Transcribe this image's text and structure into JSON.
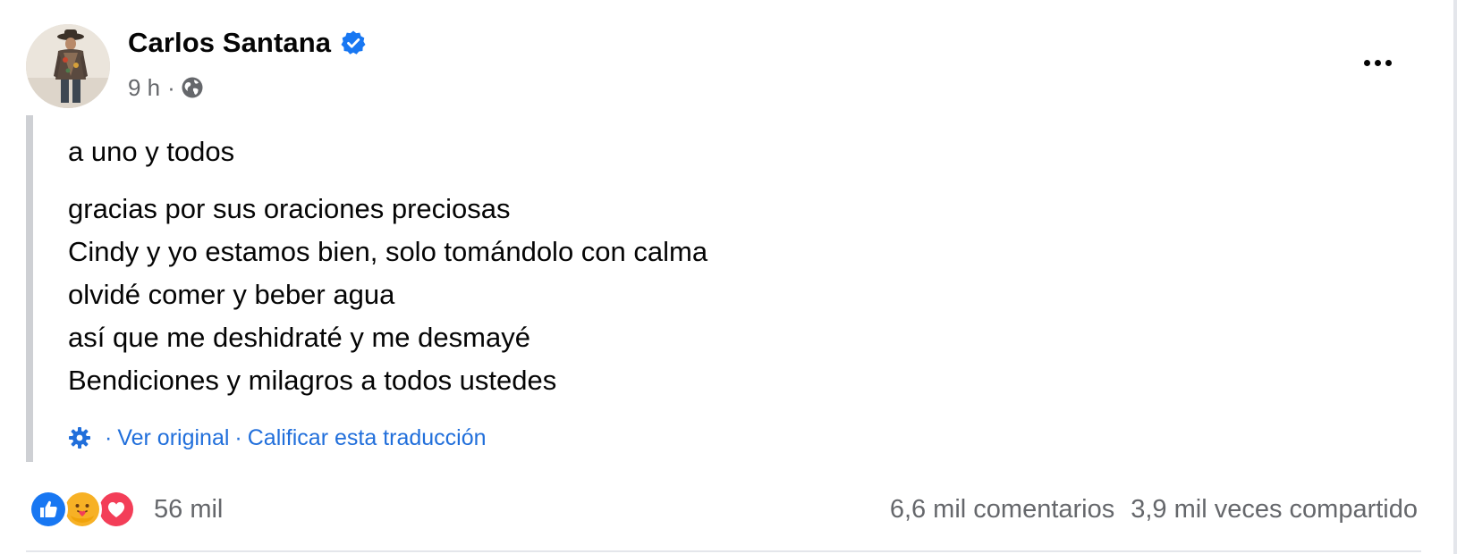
{
  "post": {
    "author_name": "Carlos Santana",
    "time": "9 h",
    "separator": "·",
    "body_lines": [
      "a uno y todos",
      "gracias por sus oraciones preciosas",
      "Cindy y yo estamos bien, solo tomándolo con calma",
      "olvidé comer y beber agua",
      "así que me deshidraté y me desmayé",
      "Bendiciones y milagros a todos ustedes"
    ],
    "translation": {
      "separator": "·",
      "view_original": "Ver original",
      "rate_translation": "Calificar esta traducción"
    }
  },
  "footer": {
    "reaction_icons": [
      "like-icon",
      "care-icon",
      "love-icon"
    ],
    "reaction_count": "56 mil",
    "comments": "6,6 mil comentarios",
    "shares": "3,9 mil veces compartido"
  },
  "colors": {
    "link_blue": "#216fdb",
    "secondary_text": "#65676b",
    "verified_blue": "#1877f2",
    "like_blue": "#1877f2",
    "love_red": "#f33e58",
    "care_yellow": "#f7b125"
  },
  "icons": {
    "verified": "verified-badge-icon",
    "privacy": "globe-icon",
    "more": "more-options-icon",
    "translation_settings": "gear-icon"
  }
}
